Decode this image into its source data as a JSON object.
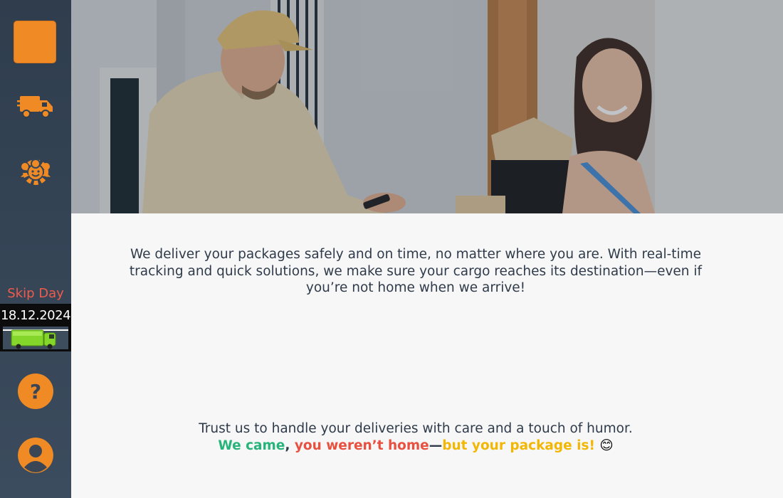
{
  "sidebar": {
    "logo": "logo-box",
    "nav": [
      {
        "name": "delivery-truck-icon"
      },
      {
        "name": "team-gear-icon"
      }
    ],
    "skip_label": "Skip Day",
    "date": "18.12.2024",
    "help_symbol": "?",
    "profile": "user-icon"
  },
  "hero": {
    "image": "courier handing packages to smiling woman at door"
  },
  "content": {
    "intro": "We deliver your packages safely and on time, no matter where you are. With real-time tracking and quick solutions, we make sure your cargo reaches its destination—even if you’re not home when we arrive!",
    "trust": "Trust us to handle your deliveries with care and a touch of humor.",
    "tagline": {
      "part1": "We came",
      "sep1": ", ",
      "part2": "you weren’t home",
      "sep2": "—",
      "part3": "but your package is!",
      "emoji": " 😊"
    }
  },
  "colors": {
    "sidebar_bg": "#2f3d4d",
    "accent_orange": "#f08a24",
    "skip_red": "#ef5b4c",
    "green": "#27b47a",
    "red": "#e8503f",
    "yellow": "#f2b705",
    "text_dark": "#2f3b4a"
  }
}
